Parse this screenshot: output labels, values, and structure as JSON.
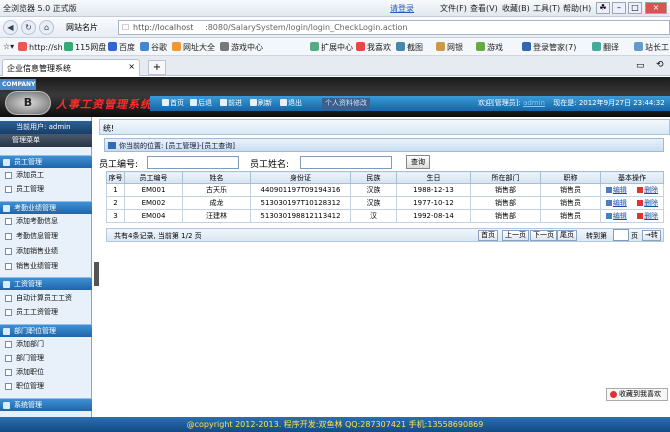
{
  "browser": {
    "title": "全浏览器 5.0 正式版",
    "login": "请登录",
    "menus": [
      "文件(F)",
      "查看(V)",
      "收藏(B)",
      "工具(T)",
      "帮助(H)"
    ],
    "site_name_label": "网站名片",
    "url_host": "http://localhost",
    "url_rest": ":8080/SalarySystem/login/login_CheckLogin.action",
    "bookmarks": [
      "http://sh",
      "115网盘",
      "百度",
      "谷歌",
      "网址大全",
      "游戏中心"
    ],
    "bookmarks_right": [
      "扩展中心",
      "我喜欢",
      "截图",
      "网银",
      "游戏",
      "登录管家(7)",
      "翻译",
      "站长工"
    ],
    "tab_title": "企业信息管理系统"
  },
  "header": {
    "company": "COMPANY",
    "logo_text": "B",
    "system_title": "人事工资管理系统",
    "nav_buttons": [
      "首页",
      "后退",
      "前进",
      "刷新",
      "退出"
    ],
    "personal_btn": "个人资料修改",
    "welcome": "欢迎[管理员]:",
    "now": "现在是: 2012年9月27日 23:44:32"
  },
  "sidebar": {
    "current_user": "当前用户: admin",
    "menu_title": "管理菜单",
    "sections": [
      {
        "title": "员工管理",
        "items": [
          "添加员工",
          "员工管理"
        ]
      },
      {
        "title": "考勤业绩管理",
        "items": [
          "添加考勤信息",
          "考勤信息管理",
          "添加销售业绩",
          "销售业绩管理"
        ]
      },
      {
        "title": "工资管理",
        "items": [
          "自动计算员工工资",
          "员工工资管理"
        ]
      },
      {
        "title": "部门职位管理",
        "items": [
          "添加部门",
          "部门管理",
          "添加职位",
          "职位管理"
        ]
      },
      {
        "title": "系统管理",
        "items": []
      }
    ]
  },
  "main": {
    "top_text": "统!",
    "location": "你当前的位置: [员工管理]-[员工查询]",
    "emp_no_label": "员工编号:",
    "emp_name_label": "员工姓名:",
    "search_btn": "查询",
    "columns": [
      "序号",
      "员工编号",
      "姓名",
      "身份证",
      "民族",
      "生日",
      "所在部门",
      "职称",
      "基本操作"
    ],
    "rows": [
      [
        "1",
        "EM001",
        "古天乐",
        "440901197T09194316",
        "汉族",
        "1988-12-13",
        "销售部",
        "销售员"
      ],
      [
        "2",
        "EM002",
        "成龙",
        "513030197T10128312",
        "汉族",
        "1977-10-12",
        "销售部",
        "销售员"
      ],
      [
        "3",
        "EM004",
        "汪建林",
        "513030198812113412",
        "汉",
        "1992-08-14",
        "销售部",
        "销售员"
      ]
    ],
    "edit_label": "编辑",
    "delete_label": "删除",
    "pager_text": "共有4条记录, 当前第 1/2 页",
    "pager_buttons": [
      "首页",
      "上一页",
      "下一页",
      "尾页"
    ],
    "jump_label": "转到第",
    "page_unit": "页",
    "go_btn": "转"
  },
  "favorite": "收藏到我喜欢",
  "footer": "@copyright 2012-2013.  程序开发:双鱼林  QQ:287307421  手机:13558690869"
}
